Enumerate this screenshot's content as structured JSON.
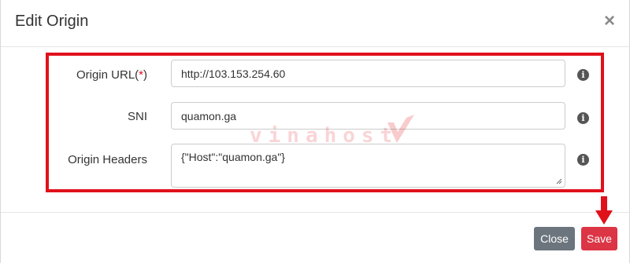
{
  "modal": {
    "title": "Edit Origin",
    "close_symbol": "×"
  },
  "form": {
    "origin_url": {
      "label": "Origin URL(",
      "required_mark": "*",
      "label_end": ")",
      "value": "http://103.153.254.60"
    },
    "sni": {
      "label": "SNI",
      "value": "quamon.ga"
    },
    "origin_headers": {
      "label": "Origin Headers",
      "value": "{\"Host\":\"quamon.ga\"}"
    },
    "info_symbol": "i"
  },
  "watermark": {
    "text": "vinahost"
  },
  "footer": {
    "close_label": "Close",
    "save_label": "Save"
  },
  "colors": {
    "highlight": "#e0111b",
    "close_button": "#6c757d",
    "save_button": "#dc3545"
  },
  "icons": [
    "close-icon",
    "info-icon",
    "resize-grip-icon",
    "arrow-down-icon"
  ]
}
